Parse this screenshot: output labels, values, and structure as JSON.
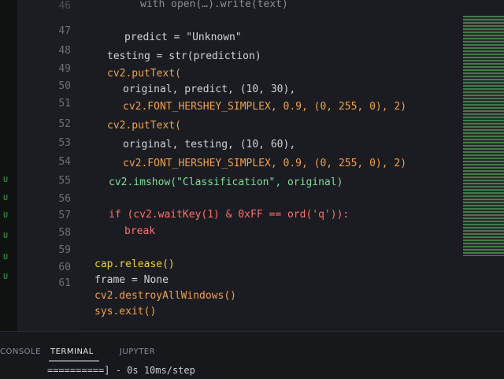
{
  "editor": {
    "line_numbers": [
      "46",
      "47",
      "48",
      "49",
      "50",
      "51",
      "52",
      "53",
      "54",
      "55",
      "56",
      "57",
      "58",
      "59",
      "60",
      "61"
    ],
    "top_partial": "with open(…).write(text)",
    "lines": [
      {
        "n": "",
        "text": "predict = \"Unknown\""
      },
      {
        "n": "",
        "text": "testing = str(prediction)"
      },
      {
        "n": "",
        "text": "cv2.putText("
      },
      {
        "n": "",
        "text": "original, predict, (10, 30),"
      },
      {
        "n": "",
        "text": "cv2.FONT_HERSHEY_SIMPLEX, 0.9, (0, 255, 0), 2)"
      },
      {
        "n": "",
        "text": "cv2.putText("
      },
      {
        "n": "",
        "text": "original, testing, (10, 60),"
      },
      {
        "n": "",
        "text": "cv2.FONT_HERSHEY_SIMPLEX, 0.9, (0, 255, 0), 2)"
      },
      {
        "n": "",
        "text": "cv2.imshow(\"Classification\", original)"
      },
      {
        "n": "",
        "text": ""
      },
      {
        "n": "",
        "text": "if (cv2.waitKey(1) & 0xFF == ord('q')):"
      },
      {
        "n": "",
        "text": "break"
      },
      {
        "n": "",
        "text": ""
      },
      {
        "n": "",
        "text": "cap.release()"
      },
      {
        "n": "",
        "text": "frame = None"
      },
      {
        "n": "",
        "text": "cv2.destroyAllWindows()"
      },
      {
        "n": "",
        "text": "sys.exit()"
      }
    ]
  },
  "panel": {
    "tabs": [
      "CONSOLE",
      "TERMINAL",
      "JUPYTER"
    ],
    "active_tab": "TERMINAL",
    "terminal_output": "==========] - 0s 10ms/step"
  },
  "colors": {
    "background": "#1a1c21",
    "accent_green": "#3e8e41",
    "cv2": "#f0a04b",
    "string": "#7fdc9a",
    "keyword": "#ff6f6f"
  }
}
